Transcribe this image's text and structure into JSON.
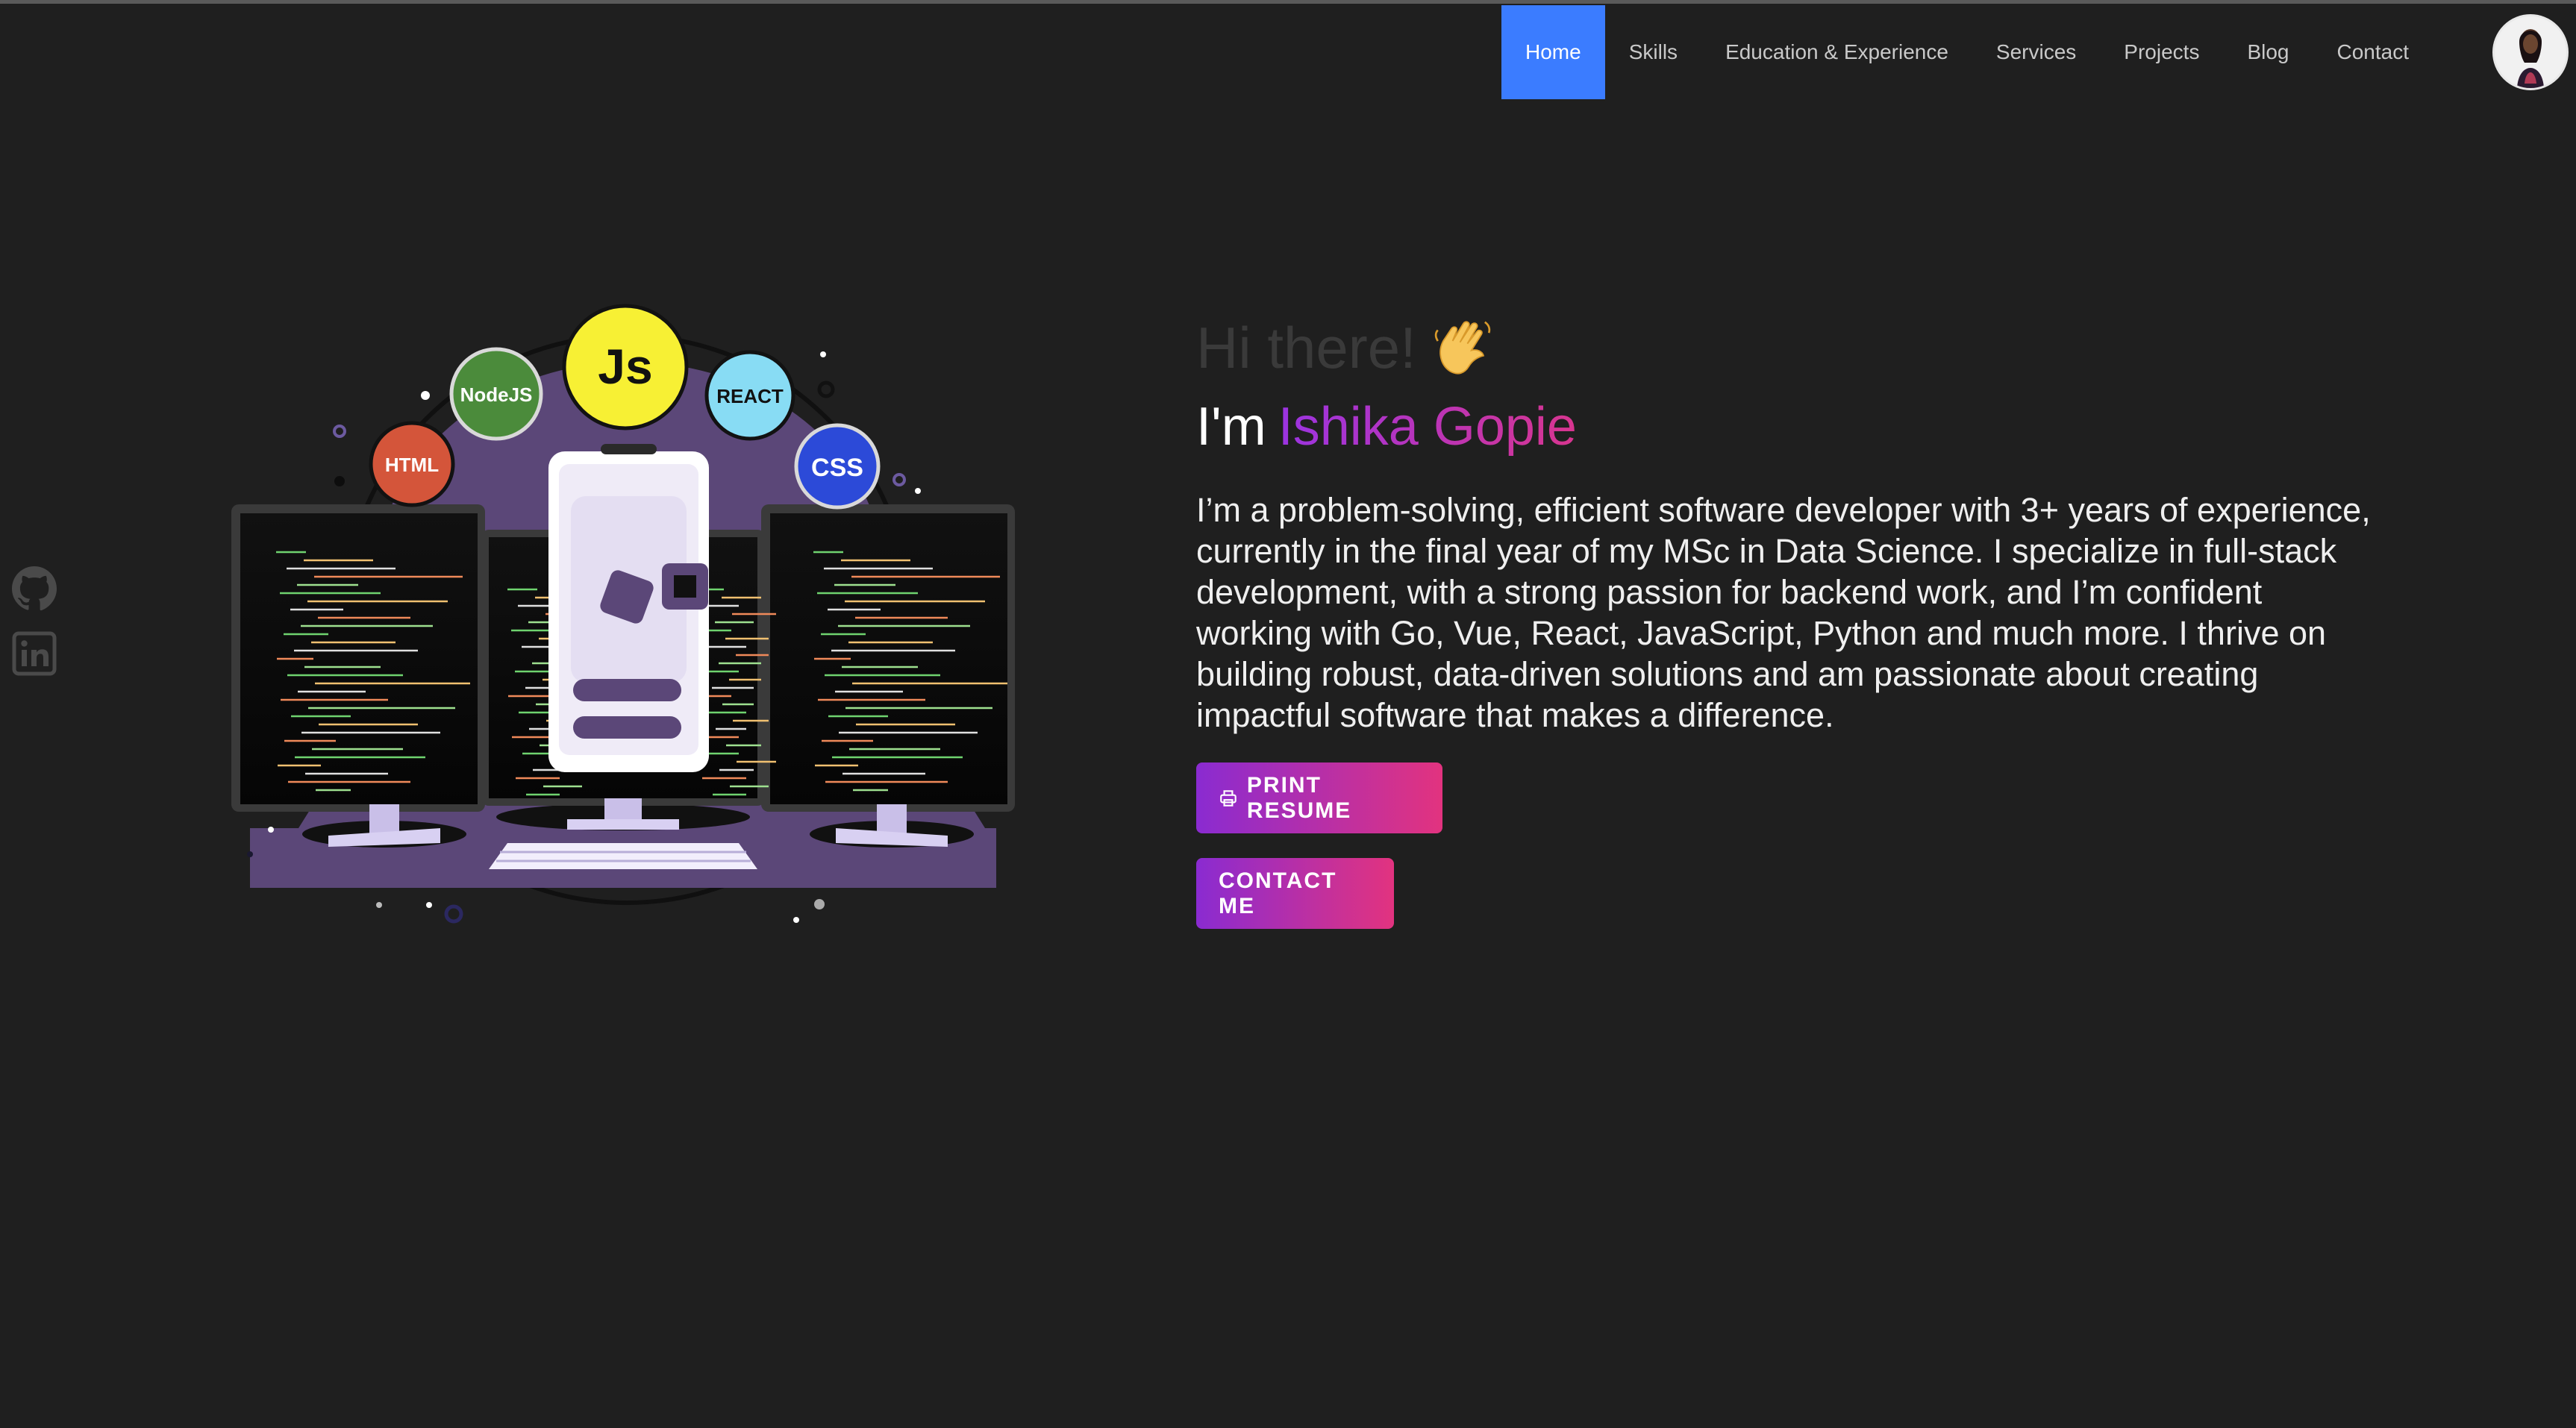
{
  "nav": {
    "items": [
      "Home",
      "Skills",
      "Education & Experience",
      "Services",
      "Projects",
      "Blog",
      "Contact"
    ],
    "active": "Home"
  },
  "hero": {
    "greeting": "Hi there!",
    "intro_prefix": "I'm",
    "name": "Ishika Gopie",
    "bio": "I’m a problem-solving, efficient software developer with 3+ years of experience, currently in the final year of my MSc in Data Science. I specialize in full-stack development, with a strong passion for backend work, and I’m confident working with Go, Vue, React, JavaScript, Python and much more. I thrive on building robust, data-driven solutions and am passionate about creating impactful software that makes a difference.",
    "print_resume_label": "PRINT RESUME",
    "contact_label": "CONTACT ME"
  },
  "illustration": {
    "badges": [
      "HTML",
      "NodeJS",
      "Js",
      "REACT",
      "CSS"
    ]
  },
  "social": {
    "icons": [
      "github-icon",
      "linkedin-icon"
    ]
  },
  "colors": {
    "background": "#1f1f1f",
    "nav_active": "#3b7cff",
    "gradient_start": "#8a2bd1",
    "gradient_end": "#e2337f",
    "illustration_purple": "#5b4778"
  }
}
